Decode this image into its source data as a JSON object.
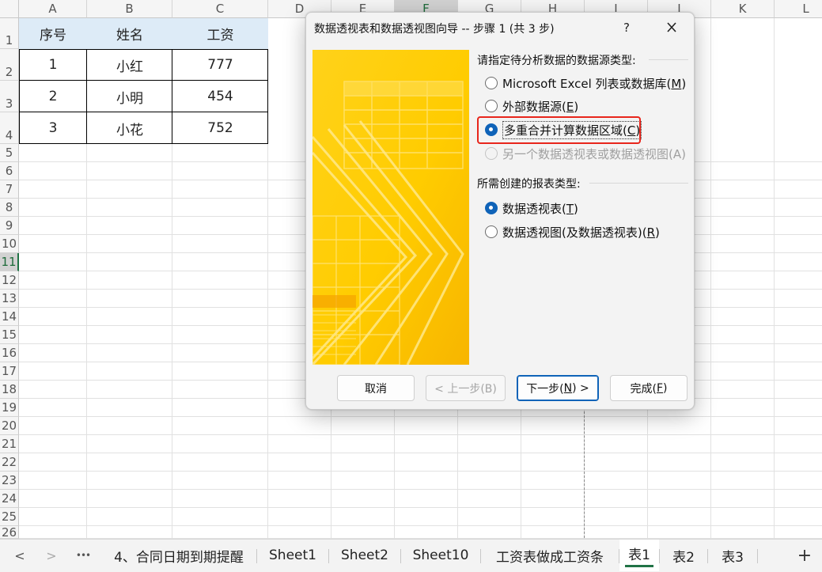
{
  "spreadsheet": {
    "columns": [
      "A",
      "B",
      "C",
      "D",
      "E",
      "F",
      "G",
      "H",
      "I",
      "J",
      "K",
      "L"
    ],
    "selected_column": "F",
    "rows": [
      "1",
      "2",
      "3",
      "4",
      "5",
      "6",
      "7",
      "8",
      "9",
      "10",
      "11",
      "12",
      "13",
      "14",
      "15",
      "16",
      "17",
      "18",
      "19",
      "20",
      "21",
      "22",
      "23",
      "24",
      "25",
      "26"
    ],
    "selected_row": "11",
    "table": {
      "headers": [
        "序号",
        "姓名",
        "工资"
      ],
      "rows": [
        [
          "1",
          "小红",
          "777"
        ],
        [
          "2",
          "小明",
          "454"
        ],
        [
          "3",
          "小花",
          "752"
        ]
      ]
    }
  },
  "dialog": {
    "title": "数据透视表和数据透视图向导 -- 步骤 1 (共 3 步)",
    "help_label": "?",
    "close_icon": "close-icon",
    "source_section_label": "请指定待分析数据的数据源类型:",
    "source_options": [
      {
        "label": "Microsoft Excel 列表或数据库",
        "key": "M",
        "selected": false,
        "enabled": true
      },
      {
        "label": "外部数据源",
        "key": "E",
        "selected": false,
        "enabled": true
      },
      {
        "label": "多重合并计算数据区域",
        "key": "C",
        "selected": true,
        "enabled": true,
        "highlighted": true
      },
      {
        "label": "另一个数据透视表或数据透视图",
        "key": "A",
        "selected": false,
        "enabled": false
      }
    ],
    "report_section_label": "所需创建的报表类型:",
    "report_options": [
      {
        "label": "数据透视表",
        "key": "T",
        "selected": true
      },
      {
        "label": "数据透视图(及数据透视表)",
        "key": "R",
        "selected": false
      }
    ],
    "buttons": {
      "cancel": "取消",
      "back": "< 上一步(B)",
      "next_prefix": "下一步(",
      "next_key": "N",
      "next_suffix": ") >",
      "finish_prefix": "完成(",
      "finish_key": "F",
      "finish_suffix": ")"
    },
    "accent_color": "#0f63b8",
    "highlight_color": "#e8261c"
  },
  "sheet_tabs": {
    "nav": {
      "prev": "<",
      "next": ">",
      "more": "•••",
      "add": "+"
    },
    "tabs": [
      "4、合同日期到期提醒",
      "Sheet1",
      "Sheet2",
      "Sheet10",
      "工资表做成工资条",
      "表1",
      "表2",
      "表3"
    ],
    "active": "表1"
  }
}
